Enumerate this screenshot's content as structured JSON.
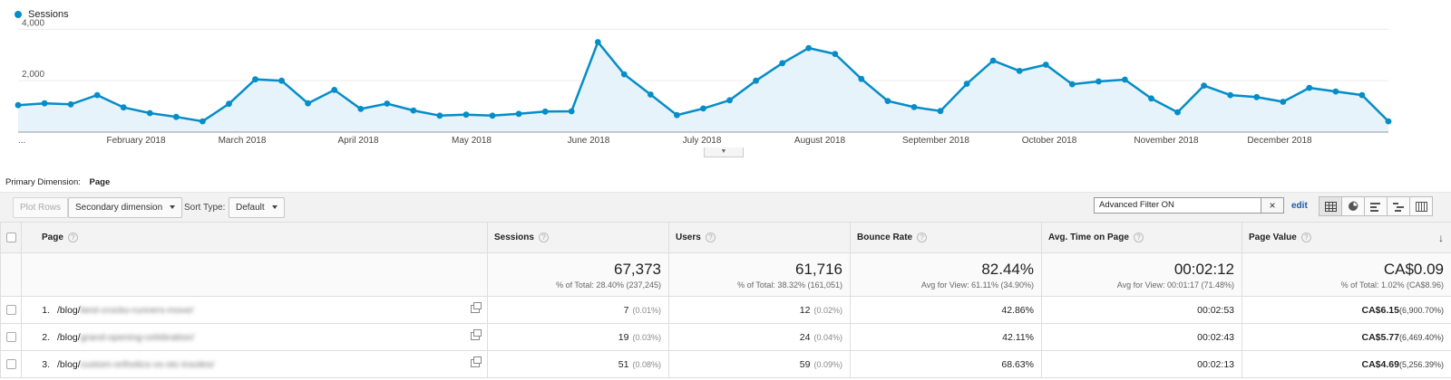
{
  "chart": {
    "legend": "Sessions",
    "color": "#058dc7",
    "y_ticks": [
      "4,000",
      "2,000"
    ],
    "x_labels": [
      "...",
      "February 2018",
      "March 2018",
      "April 2018",
      "May 2018",
      "June 2018",
      "July 2018",
      "August 2018",
      "September 2018",
      "October 2018",
      "November 2018",
      "December 2018"
    ]
  },
  "chart_data": {
    "type": "area",
    "series": [
      {
        "name": "Sessions",
        "values": [
          1050,
          1120,
          1080,
          1440,
          960,
          740,
          590,
          420,
          1100,
          2050,
          2000,
          1120,
          1640,
          900,
          1110,
          840,
          640,
          680,
          640,
          710,
          800,
          810,
          3500,
          2250,
          1460,
          660,
          920,
          1240,
          2000,
          2680,
          3270,
          3040,
          2070,
          1210,
          970,
          820,
          1880,
          2780,
          2380,
          2620,
          1860,
          1970,
          2040,
          1310,
          770,
          1810,
          1440,
          1360,
          1180,
          1720,
          1580,
          1440,
          420
        ]
      }
    ],
    "ylim": [
      0,
      4000
    ],
    "grid": true
  },
  "primary_dimension": {
    "label": "Primary Dimension:",
    "value": "Page"
  },
  "toolbar": {
    "plot_rows": "Plot Rows",
    "secondary_dimension": "Secondary dimension",
    "sort_type_label": "Sort Type:",
    "sort_type_value": "Default",
    "filter_value": "Advanced Filter ON",
    "clear_icon": "×",
    "edit": "edit"
  },
  "table": {
    "headers": {
      "page": "Page",
      "sessions": "Sessions",
      "users": "Users",
      "bounce": "Bounce Rate",
      "avg_time": "Avg. Time on Page",
      "page_value": "Page Value"
    },
    "totals": {
      "sessions": "67,373",
      "sessions_sub": "% of Total: 28.40% (237,245)",
      "users": "61,716",
      "users_sub": "% of Total: 38.32% (161,051)",
      "bounce": "82.44%",
      "bounce_sub": "Avg for View: 61.11% (34.90%)",
      "avg_time": "00:02:12",
      "avg_time_sub": "Avg for View: 00:01:17 (71.48%)",
      "page_value": "CA$0.09",
      "page_value_sub": "% of Total: 1.02% (CA$8.96)"
    },
    "rows": [
      {
        "num": "1.",
        "prefix": "/blog/",
        "slug": "best-crocks-runners-move/",
        "sessions": "7",
        "sessions_pct": "(0.01%)",
        "users": "12",
        "users_pct": "(0.02%)",
        "bounce": "42.86%",
        "avg_time": "00:02:53",
        "page_value": "CA$6.15",
        "page_value_pct": "(6,900.70%)"
      },
      {
        "num": "2.",
        "prefix": "/blog/",
        "slug": "grand-opening-celebration/",
        "sessions": "19",
        "sessions_pct": "(0.03%)",
        "users": "24",
        "users_pct": "(0.04%)",
        "bounce": "42.11%",
        "avg_time": "00:02:43",
        "page_value": "CA$5.77",
        "page_value_pct": "(6,469.40%)"
      },
      {
        "num": "3.",
        "prefix": "/blog/",
        "slug": "custom-orthotics-vs-otc-insoles/",
        "sessions": "51",
        "sessions_pct": "(0.08%)",
        "users": "59",
        "users_pct": "(0.09%)",
        "bounce": "68.63%",
        "avg_time": "00:02:13",
        "page_value": "CA$4.69",
        "page_value_pct": "(5,256.39%)"
      }
    ]
  }
}
